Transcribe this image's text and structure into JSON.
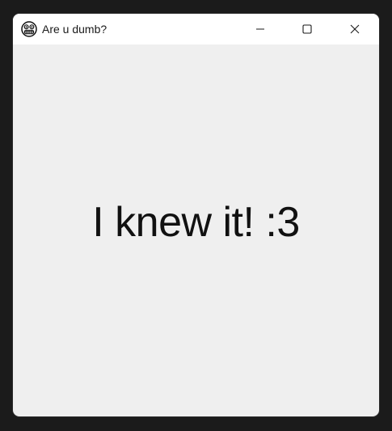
{
  "window": {
    "title": "Are u dumb?",
    "app_icon": "grimacing-face-icon",
    "controls": {
      "minimize_icon": "minimize-icon",
      "maximize_icon": "maximize-icon",
      "close_icon": "close-icon"
    }
  },
  "content": {
    "message": "I knew it! :3"
  },
  "colors": {
    "titlebar": "#ffffff",
    "client_area": "#efefef",
    "text": "#111111",
    "desktop": "#1b1b1b"
  }
}
